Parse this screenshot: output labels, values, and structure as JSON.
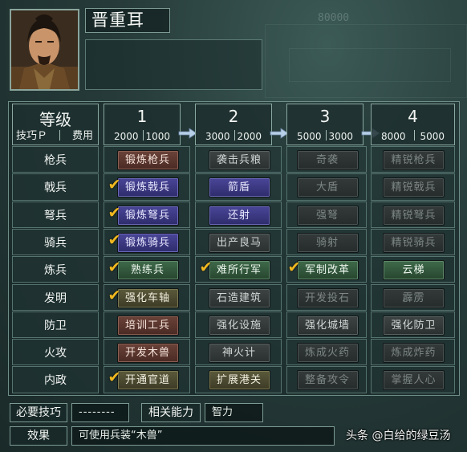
{
  "character": {
    "name": "晋重耳"
  },
  "background_number": "80000",
  "header": {
    "level_label": "等级",
    "skill_points_label": "技巧Ｐ",
    "cost_label": "费用",
    "levels": [
      {
        "number": "1",
        "cost_a": "2000",
        "cost_b": "1000"
      },
      {
        "number": "2",
        "cost_a": "3000",
        "cost_b": "2000"
      },
      {
        "number": "3",
        "cost_a": "5000",
        "cost_b": "3000"
      },
      {
        "number": "4",
        "cost_a": "8000",
        "cost_b": "5000"
      }
    ]
  },
  "rows": [
    {
      "label": "枪兵",
      "cells": [
        {
          "text": "锻炼枪兵",
          "style": "red",
          "checked": false
        },
        {
          "text": "袭击兵粮",
          "style": "dark",
          "checked": false
        },
        {
          "text": "奇袭",
          "style": "locked",
          "checked": false
        },
        {
          "text": "精锐枪兵",
          "style": "locked",
          "checked": false
        }
      ]
    },
    {
      "label": "戟兵",
      "cells": [
        {
          "text": "锻炼戟兵",
          "style": "blue",
          "checked": true
        },
        {
          "text": "箭盾",
          "style": "blue",
          "checked": false
        },
        {
          "text": "大盾",
          "style": "locked",
          "checked": false
        },
        {
          "text": "精锐戟兵",
          "style": "locked",
          "checked": false
        }
      ]
    },
    {
      "label": "弩兵",
      "cells": [
        {
          "text": "锻炼弩兵",
          "style": "blue",
          "checked": true
        },
        {
          "text": "还射",
          "style": "blue",
          "checked": false
        },
        {
          "text": "强弩",
          "style": "locked",
          "checked": false
        },
        {
          "text": "精锐弩兵",
          "style": "locked",
          "checked": false
        }
      ]
    },
    {
      "label": "骑兵",
      "cells": [
        {
          "text": "锻炼骑兵",
          "style": "blue",
          "checked": true
        },
        {
          "text": "出产良马",
          "style": "dark",
          "checked": false
        },
        {
          "text": "骑射",
          "style": "locked",
          "checked": false
        },
        {
          "text": "精锐骑兵",
          "style": "locked",
          "checked": false
        }
      ]
    },
    {
      "label": "炼兵",
      "cells": [
        {
          "text": "熟练兵",
          "style": "green",
          "checked": true
        },
        {
          "text": "难所行军",
          "style": "green",
          "checked": true
        },
        {
          "text": "军制改革",
          "style": "green",
          "checked": true
        },
        {
          "text": "云梯",
          "style": "green",
          "checked": false
        }
      ]
    },
    {
      "label": "发明",
      "cells": [
        {
          "text": "强化车轴",
          "style": "olive",
          "checked": true
        },
        {
          "text": "石造建筑",
          "style": "dark",
          "checked": false
        },
        {
          "text": "开发投石",
          "style": "locked",
          "checked": false
        },
        {
          "text": "霹雳",
          "style": "locked",
          "checked": false
        }
      ]
    },
    {
      "label": "防卫",
      "cells": [
        {
          "text": "培训工兵",
          "style": "red",
          "checked": false
        },
        {
          "text": "强化设施",
          "style": "dark",
          "checked": false
        },
        {
          "text": "强化城墙",
          "style": "dark",
          "checked": false
        },
        {
          "text": "强化防卫",
          "style": "dark",
          "checked": false
        }
      ]
    },
    {
      "label": "火攻",
      "cells": [
        {
          "text": "开发木兽",
          "style": "red",
          "checked": false
        },
        {
          "text": "神火计",
          "style": "dark",
          "checked": false
        },
        {
          "text": "炼成火药",
          "style": "locked",
          "checked": false
        },
        {
          "text": "炼成炸药",
          "style": "locked",
          "checked": false
        }
      ]
    },
    {
      "label": "内政",
      "cells": [
        {
          "text": "开通官道",
          "style": "olive",
          "checked": true
        },
        {
          "text": "扩展港关",
          "style": "olive",
          "checked": false
        },
        {
          "text": "整备攻令",
          "style": "locked",
          "checked": false
        },
        {
          "text": "掌握人心",
          "style": "locked",
          "checked": false
        }
      ]
    }
  ],
  "footer": {
    "required_skill_label": "必要技巧",
    "required_skill_value": "--------",
    "related_ability_label": "相关能力",
    "related_ability_value": "智力",
    "effect_label": "效果",
    "effect_value": "可使用兵装“木兽”"
  },
  "watermark": "头条 @白给的绿豆汤",
  "icons": {
    "check": "check-icon",
    "arrow": "arrow-right-icon"
  }
}
